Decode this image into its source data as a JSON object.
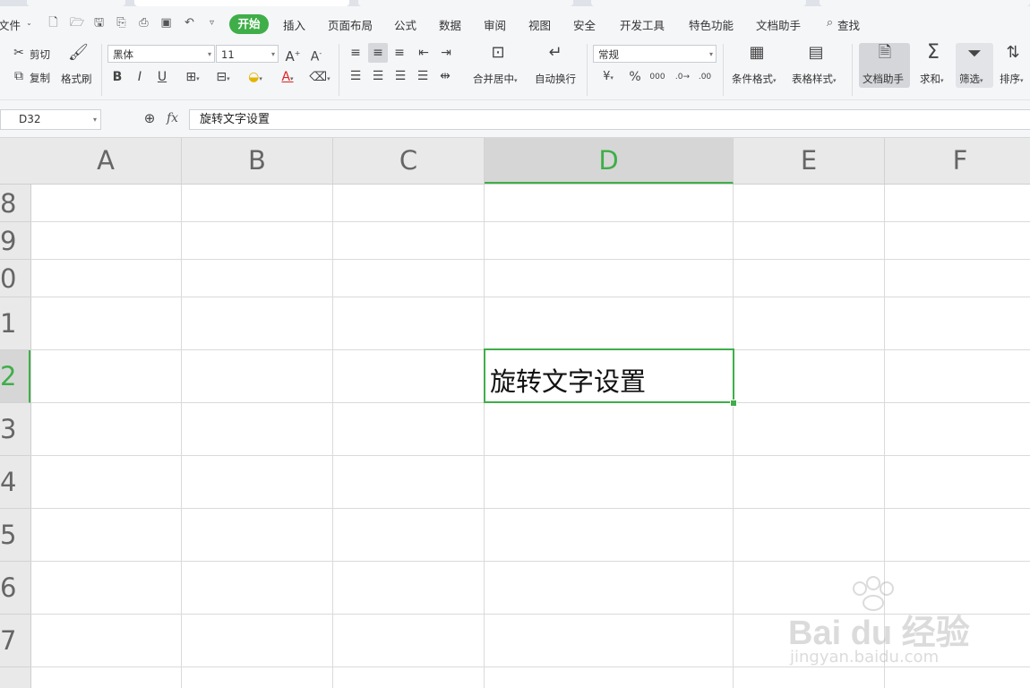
{
  "menu": {
    "file": "文件",
    "home": "开始",
    "insert": "插入",
    "page_layout": "页面布局",
    "formulas": "公式",
    "data": "数据",
    "review": "审阅",
    "view": "视图",
    "security": "安全",
    "developer": "开发工具",
    "features": "特色功能",
    "doc_assistant": "文档助手",
    "search": "查找"
  },
  "ribbon": {
    "cut": "剪切",
    "copy": "复制",
    "format_painter": "格式刷",
    "font_name": "黑体",
    "font_size": "11",
    "bold": "B",
    "italic": "I",
    "underline": "U",
    "merge_center": "合并居中",
    "wrap_text": "自动换行",
    "number_format": "常规",
    "percent": "%",
    "conditional_format": "条件格式",
    "table_style": "表格样式",
    "doc_assistant": "文档助手",
    "sum": "求和",
    "filter": "筛选",
    "sort": "排序"
  },
  "formula_bar": {
    "name_box": "D32",
    "fx": "fx",
    "content": "旋转文字设置"
  },
  "columns": [
    "A",
    "B",
    "C",
    "D",
    "E",
    "F"
  ],
  "rows": [
    "8",
    "9",
    "0",
    "1",
    "2",
    "3",
    "4",
    "5",
    "6",
    "7"
  ],
  "active_cell": {
    "value": "旋转文字设置"
  },
  "watermark": {
    "brand": "Bai du 经验",
    "url": "jingyan.baidu.com"
  },
  "colors": {
    "accent": "#3fae49"
  }
}
